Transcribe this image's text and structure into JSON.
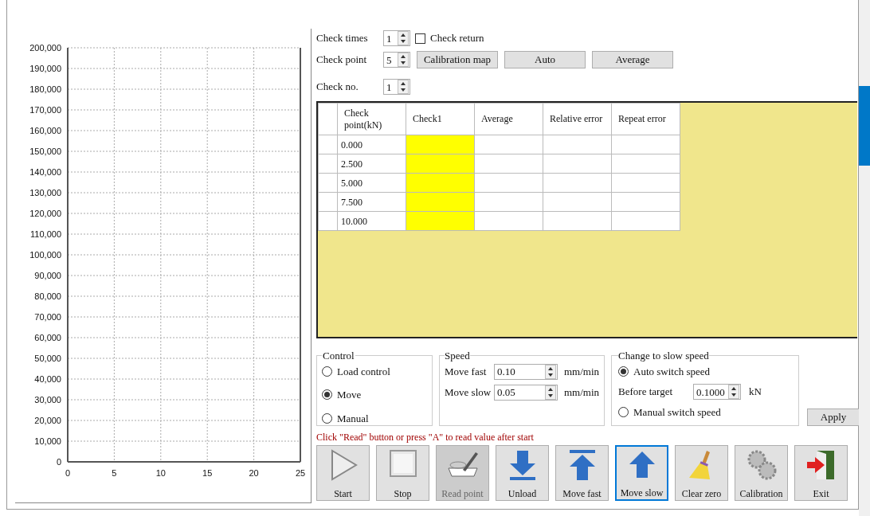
{
  "chart": {
    "chart_data": {
      "type": "line",
      "grid": true,
      "xlim": [
        0,
        25
      ],
      "ylim": [
        0,
        200000
      ],
      "xticks": [
        0,
        5,
        10,
        15,
        20,
        25
      ],
      "yticks": [
        {
          "value": 0,
          "label": "0"
        },
        {
          "value": 10000,
          "label": "10,000"
        },
        {
          "value": 20000,
          "label": "20,000"
        },
        {
          "value": 30000,
          "label": "30,000"
        },
        {
          "value": 40000,
          "label": "40,000"
        },
        {
          "value": 50000,
          "label": "50,000"
        },
        {
          "value": 60000,
          "label": "60,000"
        },
        {
          "value": 70000,
          "label": "70,000"
        },
        {
          "value": 80000,
          "label": "80,000"
        },
        {
          "value": 90000,
          "label": "90,000"
        },
        {
          "value": 100000,
          "label": "100,000"
        },
        {
          "value": 110000,
          "label": "110,000"
        },
        {
          "value": 120000,
          "label": "120,000"
        },
        {
          "value": 130000,
          "label": "130,000"
        },
        {
          "value": 140000,
          "label": "140,000"
        },
        {
          "value": 150000,
          "label": "150,000"
        },
        {
          "value": 160000,
          "label": "160,000"
        },
        {
          "value": 170000,
          "label": "170,000"
        },
        {
          "value": 180000,
          "label": "180,000"
        },
        {
          "value": 190000,
          "label": "190,000"
        },
        {
          "value": 200000,
          "label": "200,000"
        }
      ]
    }
  },
  "check_settings": {
    "check_times": {
      "label": "Check times",
      "value": "1"
    },
    "check_return": {
      "label": "Check return",
      "checked": false
    },
    "check_point": {
      "label": "Check point",
      "value": "5"
    },
    "buttons": [
      "Calibration map",
      "Auto",
      "Average"
    ],
    "check_no": {
      "label": "Check no.",
      "value": "1"
    }
  },
  "table": {
    "columns": [
      {
        "label": "Check point(kN)",
        "highlighted": false
      },
      {
        "label": "Check1",
        "highlighted": true
      },
      {
        "label": "Average",
        "highlighted": false
      },
      {
        "label": "Relative error",
        "highlighted": false
      },
      {
        "label": "Repeat error",
        "highlighted": false
      }
    ],
    "rows": [
      {
        "check_point": "0.000"
      },
      {
        "check_point": "2.500"
      },
      {
        "check_point": "5.000"
      },
      {
        "check_point": "7.500"
      },
      {
        "check_point": "10.000"
      }
    ]
  },
  "control": {
    "title": "Control",
    "options": [
      {
        "label": "Load control",
        "selected": false
      },
      {
        "label": "Move",
        "selected": true
      },
      {
        "label": "Manual",
        "selected": false
      }
    ]
  },
  "speed": {
    "title": "Speed",
    "fields": [
      {
        "label": "Move fast",
        "value": "0.10",
        "unit": "mm/min"
      },
      {
        "label": "Move slow",
        "value": "0.05",
        "unit": "mm/min"
      }
    ]
  },
  "slow_speed": {
    "title": "Change to slow speed",
    "options": [
      {
        "label": "Auto switch speed",
        "selected": true
      },
      {
        "label": "Manual switch speed",
        "selected": false
      }
    ],
    "before_target": {
      "label": "Before target",
      "value": "0.1000",
      "unit": "kN"
    }
  },
  "apply_button": "Apply",
  "hint": "Click \"Read\" button or press \"A\" to read value after start",
  "toolbar": [
    {
      "label": "Start",
      "kind": "play",
      "disabled": false,
      "selected": false
    },
    {
      "label": "Stop",
      "kind": "stop",
      "disabled": false,
      "selected": false
    },
    {
      "label": "Read point",
      "kind": "pen",
      "disabled": true,
      "selected": false
    },
    {
      "label": "Unload",
      "kind": "down",
      "disabled": false,
      "selected": false
    },
    {
      "label": "Move fast",
      "kind": "up-bar",
      "disabled": false,
      "selected": false
    },
    {
      "label": "Move slow",
      "kind": "up",
      "disabled": false,
      "selected": true
    },
    {
      "label": "Clear zero",
      "kind": "broom",
      "disabled": false,
      "selected": false
    },
    {
      "label": "Calibration",
      "kind": "gears",
      "disabled": false,
      "selected": false
    },
    {
      "label": "Exit",
      "kind": "exit",
      "disabled": false,
      "selected": false
    }
  ]
}
